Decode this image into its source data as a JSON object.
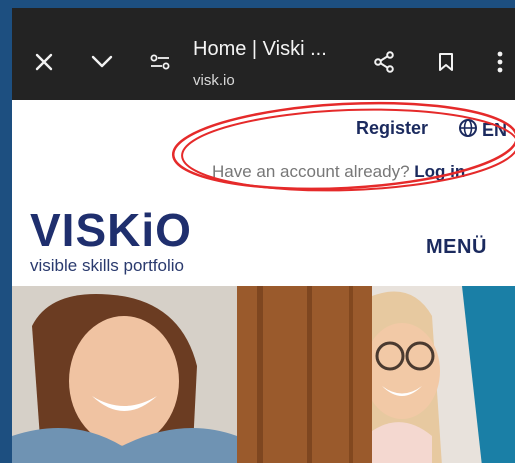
{
  "browser": {
    "title": "Home | Viski ...",
    "url": "visk.io",
    "icons": [
      "close-icon",
      "chevron-down-icon",
      "page-info-icon",
      "share-icon",
      "bookmark-icon",
      "more-vertical-icon"
    ]
  },
  "header": {
    "register_label": "Register",
    "language_label": "EN",
    "account_prompt": "Have an account already?",
    "login_label": "Log in"
  },
  "brand": {
    "logo_word": "VISKiO",
    "tagline": "visible skills portfolio"
  },
  "nav": {
    "menu_label": "MENÜ"
  },
  "colors": {
    "brand_navy": "#1f2f6e",
    "toolbar_bg": "#232323",
    "annotation_red": "#e52a2a",
    "outer_bg": "#1d4f80"
  }
}
